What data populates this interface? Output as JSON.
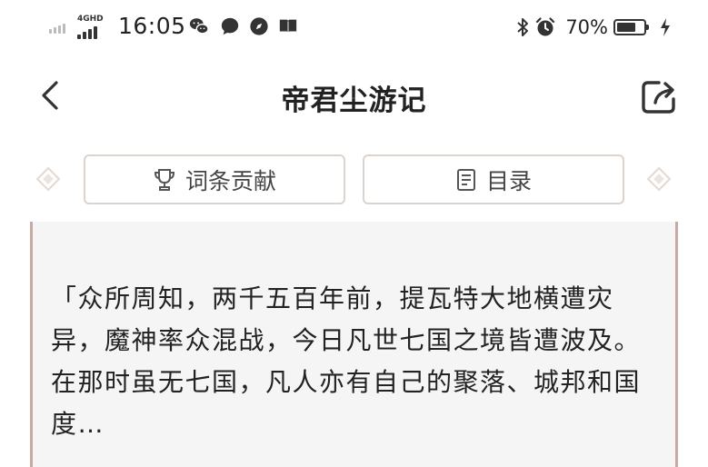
{
  "status_bar": {
    "network": "4GHD",
    "time": "16:05",
    "app_icons": [
      "wechat-icon",
      "message-icon",
      "compass-icon",
      "book-icon"
    ],
    "battery_percent": "70%",
    "battery_level": 0.7
  },
  "nav": {
    "title": "帝君尘游记"
  },
  "tabs": [
    {
      "label": "词条贡献",
      "icon": "trophy-icon"
    },
    {
      "label": "目录",
      "icon": "list-icon"
    }
  ],
  "content": {
    "text": "「众所周知，两千五百年前，提瓦特大地横遭灾异，魔神率众混战，今日凡世七国之境皆遭波及。在那时虽无七国，凡人亦有自己的聚落、城邦和国度…"
  },
  "colors": {
    "accent_border": "#c7aba3",
    "tab_border": "#dcd3cc",
    "card_bg": "#f5f5f5"
  }
}
